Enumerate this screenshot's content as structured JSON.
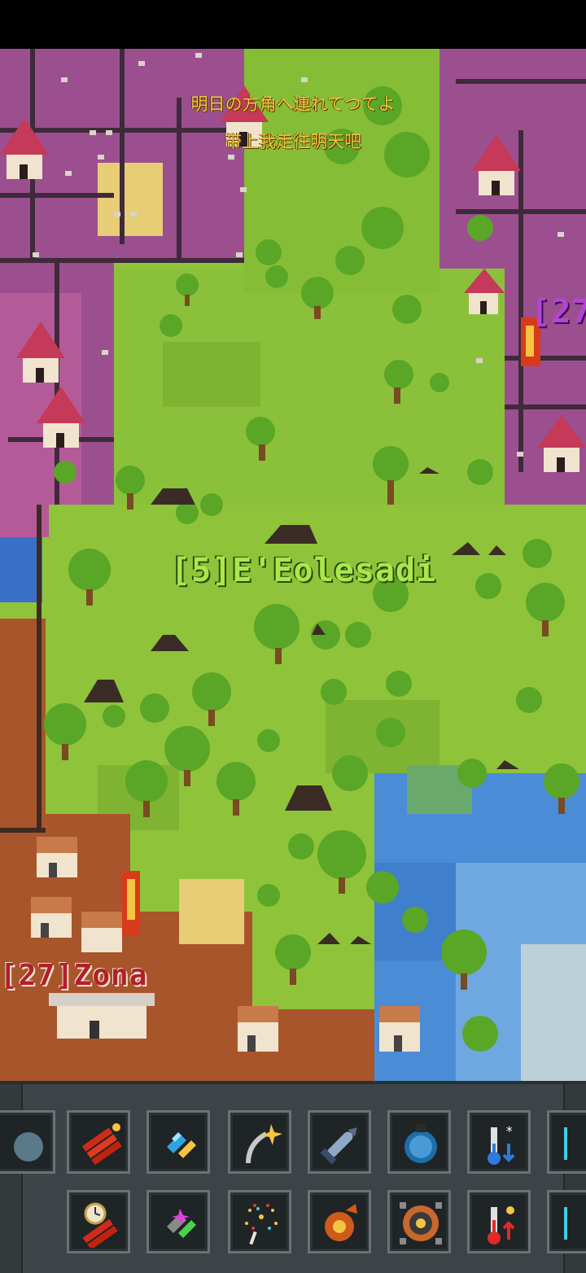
{
  "map": {
    "subtitle_jp": "明日の方角へ連れてつてよ",
    "subtitle_cn": "带上我走往明天吧",
    "kingdoms": [
      {
        "label": "[5]E'Eolesadi",
        "color": "#a8e84a"
      },
      {
        "label": "[27]Zona",
        "color": "#b21f2a"
      },
      {
        "label": "[27",
        "color": "#b245d6"
      }
    ]
  },
  "toolbar": {
    "row1": [
      {
        "icon": "bomb-partial-icon"
      },
      {
        "icon": "dynamite-icon"
      },
      {
        "icon": "blue-crystal-icon"
      },
      {
        "icon": "grenade-spark-icon"
      },
      {
        "icon": "missile-icon"
      },
      {
        "icon": "shield-bomb-icon"
      },
      {
        "icon": "thermometer-cold-icon"
      },
      {
        "icon": "partial-tool-icon"
      }
    ],
    "row2": [
      {
        "icon": "timed-bomb-icon"
      },
      {
        "icon": "spark-crystal-icon"
      },
      {
        "icon": "fireworks-icon"
      },
      {
        "icon": "nuke-icon"
      },
      {
        "icon": "atomic-bomb-icon"
      },
      {
        "icon": "thermometer-hot-icon"
      },
      {
        "icon": "partial-tool-icon"
      }
    ]
  }
}
